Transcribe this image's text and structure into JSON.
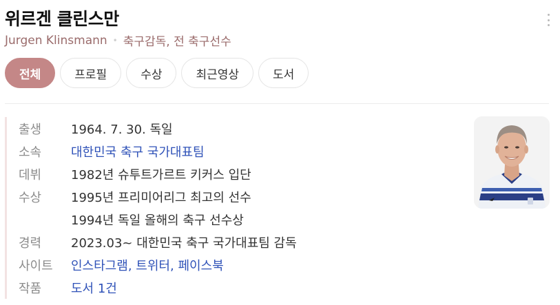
{
  "header": {
    "title": "위르겐 클린스만",
    "subtitle_name": "Jurgen Klinsmann",
    "subtitle_sep": "•",
    "subtitle_occupation": "축구감독, 전 축구선수"
  },
  "tabs": [
    {
      "label": "전체",
      "active": true
    },
    {
      "label": "프로필"
    },
    {
      "label": "수상"
    },
    {
      "label": "최근영상"
    },
    {
      "label": "도서"
    }
  ],
  "info": {
    "birth": {
      "label": "출생",
      "value": "1964. 7. 30. 독일"
    },
    "team": {
      "label": "소속",
      "value": "대한민국 축구 국가대표팀"
    },
    "debut": {
      "label": "데뷔",
      "value": "1982년 슈투트가르트 키커스 입단"
    },
    "award": {
      "label": "수상",
      "values": [
        "1995년 프리미어리그 최고의 선수",
        "1994년 독일 올해의 축구 선수상"
      ]
    },
    "career": {
      "label": "경력",
      "value": "2023.03~ 대한민국 축구 국가대표팀 감독"
    },
    "site": {
      "label": "사이트",
      "links": [
        "인스타그램",
        "트위터",
        "페이스북"
      ],
      "separator": ","
    },
    "works": {
      "label": "작품",
      "value": "도서 1건"
    }
  },
  "colors": {
    "accent": "#c48787",
    "link": "#2f52b8",
    "label": "#8c8c8c"
  },
  "icons": {
    "more": "more-vertical-icon"
  }
}
